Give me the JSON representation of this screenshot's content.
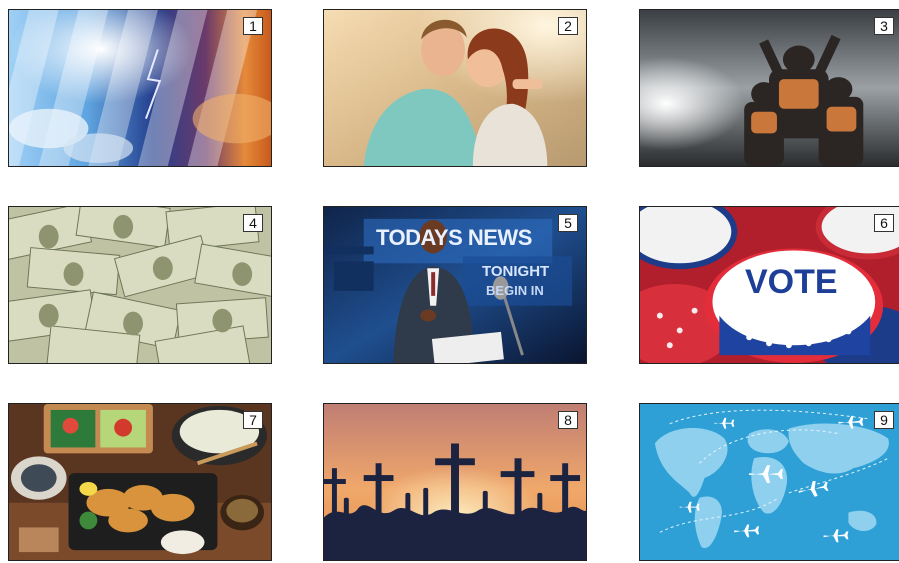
{
  "tiles": [
    {
      "number": "1",
      "subject": "weather"
    },
    {
      "number": "2",
      "subject": "romance"
    },
    {
      "number": "3",
      "subject": "football"
    },
    {
      "number": "4",
      "subject": "money"
    },
    {
      "number": "5",
      "subject": "news",
      "headline": "TODAYS NEWS",
      "subline1": "TONIGHT",
      "subline2": "BEGIN IN"
    },
    {
      "number": "6",
      "subject": "vote",
      "button_text": "VOTE"
    },
    {
      "number": "7",
      "subject": "food"
    },
    {
      "number": "8",
      "subject": "religion"
    },
    {
      "number": "9",
      "subject": "travel"
    }
  ],
  "colors": {
    "border": "#222222",
    "background": "#ffffff"
  }
}
